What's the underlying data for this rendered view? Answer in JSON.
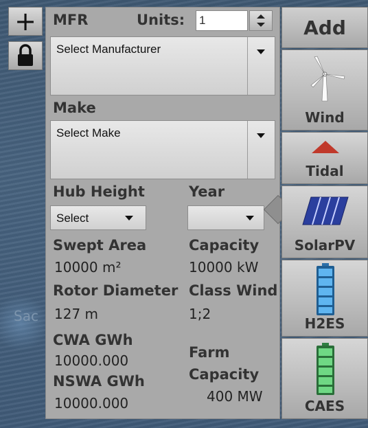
{
  "map": {
    "label": "Sac"
  },
  "map_controls": {
    "zoom_symbol": "+",
    "lock_icon": "lock-icon"
  },
  "form": {
    "mfr_label": "MFR",
    "units_label": "Units:",
    "units_value": "1",
    "manufacturer_select": "Select Manufacturer",
    "make_label": "Make",
    "make_select": "Select Make",
    "hub_height_label": "Hub Height",
    "hub_height_select": "Select",
    "year_label": "Year",
    "year_select": "",
    "swept_area_label": "Swept Area",
    "swept_area_value": "10000 m²",
    "capacity_label": "Capacity",
    "capacity_value": "10000 kW",
    "rotor_diameter_label": "Rotor Diameter",
    "rotor_diameter_value": "127 m",
    "class_wind_label": "Class Wind",
    "class_wind_value": "1;2",
    "cwa_label": "CWA GWh",
    "cwa_value": "10000.000",
    "nswa_label": "NSWA GWh",
    "nswa_value": "10000.000",
    "farm_capacity_label_1": "Farm",
    "farm_capacity_label_2": "Capacity",
    "farm_capacity_value": "400 MW"
  },
  "add_panel": {
    "header": "Add",
    "buttons": [
      {
        "label": "Wind",
        "icon": "wind-turbine-icon"
      },
      {
        "label": "Tidal",
        "icon": "tidal-triangle-icon"
      },
      {
        "label": "SolarPV",
        "icon": "solar-panel-icon"
      },
      {
        "label": "H2ES",
        "icon": "h2-battery-icon"
      },
      {
        "label": "CAES",
        "icon": "caes-battery-icon"
      }
    ]
  },
  "colors": {
    "tidal": "#c0392b",
    "solar": "#2b3f9e",
    "h2es_battery": "#3f9de0",
    "caes_battery": "#52c46a"
  }
}
